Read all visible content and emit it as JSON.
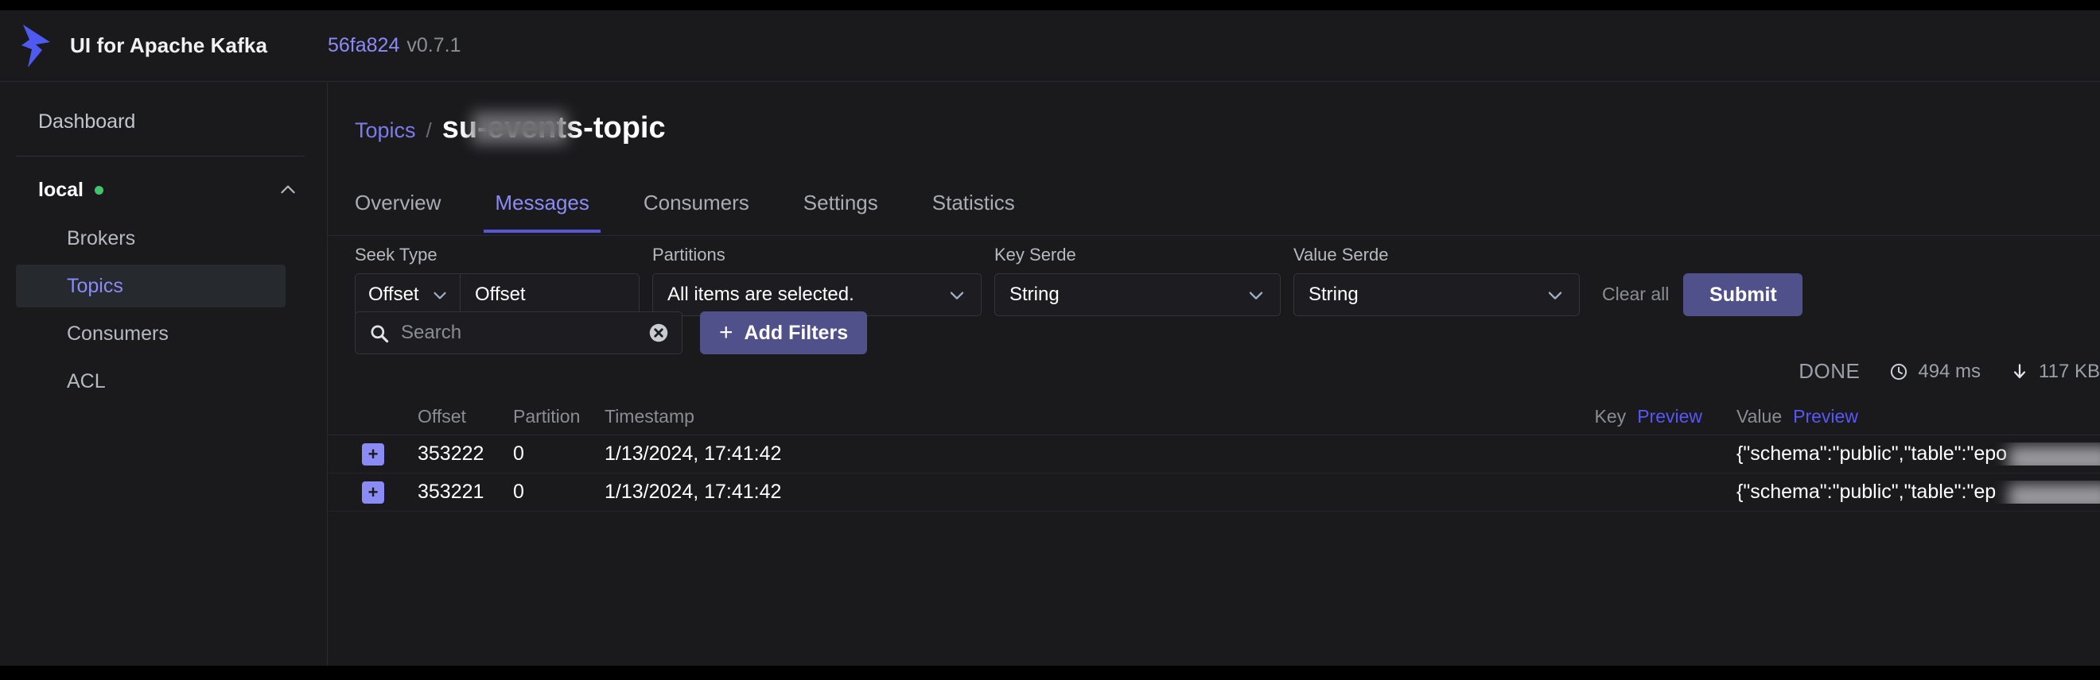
{
  "header": {
    "app_title": "UI for Apache Kafka",
    "commit": "56fa824",
    "version": "v0.7.1",
    "logo_icon": "kafka-arrow-logo",
    "brand_color": "#4f5bf0"
  },
  "sidebar": {
    "dashboard_label": "Dashboard",
    "cluster": {
      "name": "local",
      "status_color": "#41c56b",
      "collapse_icon": "chevron-up-icon"
    },
    "items": [
      {
        "label": "Brokers",
        "active": false
      },
      {
        "label": "Topics",
        "active": true
      },
      {
        "label": "Consumers",
        "active": false
      },
      {
        "label": "ACL",
        "active": false
      }
    ]
  },
  "breadcrumb": {
    "parent": "Topics",
    "separator": "/",
    "current": "su███████-events-topic",
    "current_visible_prefix": "su",
    "current_visible_suffix": "-events-topic",
    "redacted": true
  },
  "tabs": [
    {
      "label": "Overview",
      "active": false
    },
    {
      "label": "Messages",
      "active": true
    },
    {
      "label": "Consumers",
      "active": false
    },
    {
      "label": "Settings",
      "active": false
    },
    {
      "label": "Statistics",
      "active": false
    }
  ],
  "filters": {
    "seek_type": {
      "label": "Seek Type",
      "value": "Offset",
      "input_value": "Offset",
      "chevron_icon": "chevron-down-icon"
    },
    "partitions": {
      "label": "Partitions",
      "value": "All items are selected.",
      "chevron_icon": "chevron-down-icon"
    },
    "key_serde": {
      "label": "Key Serde",
      "value": "String",
      "chevron_icon": "chevron-down-icon"
    },
    "value_serde": {
      "label": "Value Serde",
      "value": "String",
      "chevron_icon": "chevron-down-icon"
    },
    "clear_all_label": "Clear all",
    "submit_label": "Submit",
    "submit_color": "#50508b"
  },
  "search": {
    "placeholder": "Search",
    "value": "",
    "search_icon": "search-icon",
    "clear_icon": "clear-circle-icon",
    "add_filters_label": "Add Filters",
    "add_filters_plus": "+"
  },
  "status": {
    "state": "DONE",
    "elapsed": "494 ms",
    "elapsed_icon": "clock-icon",
    "bytes": "117 KB",
    "bytes_icon": "download-arrow-icon"
  },
  "table": {
    "columns": {
      "offset": "Offset",
      "partition": "Partition",
      "timestamp": "Timestamp",
      "key": "Key",
      "key_preview": "Preview",
      "value": "Value",
      "value_preview": "Preview"
    },
    "rows": [
      {
        "expand": "+",
        "offset": "353222",
        "partition": "0",
        "timestamp": "1/13/2024, 17:41:42",
        "key": "",
        "value": "{\"schema\":\"public\",\"table\":\"epo"
      },
      {
        "expand": "+",
        "offset": "353221",
        "partition": "0",
        "timestamp": "1/13/2024, 17:41:42",
        "key": "",
        "value": "{\"schema\":\"public\",\"table\":\"ep"
      }
    ]
  }
}
